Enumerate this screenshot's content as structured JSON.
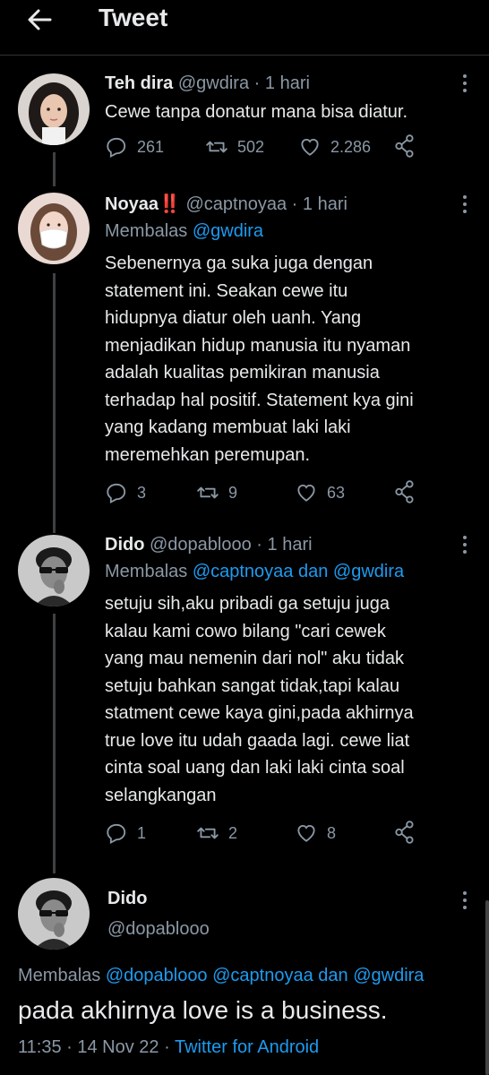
{
  "header": {
    "title": "Tweet",
    "back_icon": "arrow-left-icon"
  },
  "tweets": [
    {
      "name": "Teh dira",
      "handle": "@gwdira",
      "separator": "·",
      "time": "1 hari",
      "text": "Cewe tanpa donatur mana bisa diatur.",
      "replies": "261",
      "retweets": "502",
      "likes": "2.286"
    },
    {
      "name": "Noyaa",
      "badge": "‼️",
      "handle": "@captnoyaa",
      "separator": "·",
      "time": "1 hari",
      "reply_prefix": "Membalas",
      "reply_to": "@gwdira",
      "text_lines": [
        "Sebenernya ga suka juga dengan",
        "statement ini. Seakan cewe itu",
        "hidupnya diatur oleh uanh. Yang",
        "menjadikan hidup manusia itu nyaman",
        "adalah kualitas pemikiran manusia",
        "terhadap hal positif. Statement kya gini",
        "yang kadang membuat laki laki",
        "meremehkan peremupan."
      ],
      "replies": "3",
      "retweets": "9",
      "likes": "63"
    },
    {
      "name": "Dido",
      "handle": "@dopablooo",
      "separator": "·",
      "time": "1 hari",
      "reply_prefix": "Membalas",
      "reply_to": "@captnoyaa dan @gwdira",
      "text_lines": [
        "setuju sih,aku pribadi ga setuju juga",
        "kalau kami cowo bilang \"cari cewek",
        "yang mau nemenin dari nol\" aku tidak",
        "setuju bahkan sangat tidak,tapi kalau",
        "statment cewe kaya gini,pada akhirnya",
        "true love itu udah gaada lagi. cewe liat",
        "cinta soal uang dan laki laki cinta soal",
        "selangkangan"
      ],
      "replies": "1",
      "retweets": "2",
      "likes": "8"
    }
  ],
  "main_tweet": {
    "name": "Dido",
    "handle": "@dopablooo",
    "reply_prefix": "Membalas",
    "reply_to": "@dopablooo @captnoyaa dan @gwdira",
    "text": "pada akhirnya love is a business.",
    "time": "11:35",
    "date": "14 Nov 22",
    "separator": "·",
    "source": "Twitter for Android"
  },
  "colors": {
    "background": "#000000",
    "text": "#e7e9ea",
    "secondary": "#8b98a5",
    "link": "#1d9bf0",
    "thread_line": "#3e4144"
  }
}
